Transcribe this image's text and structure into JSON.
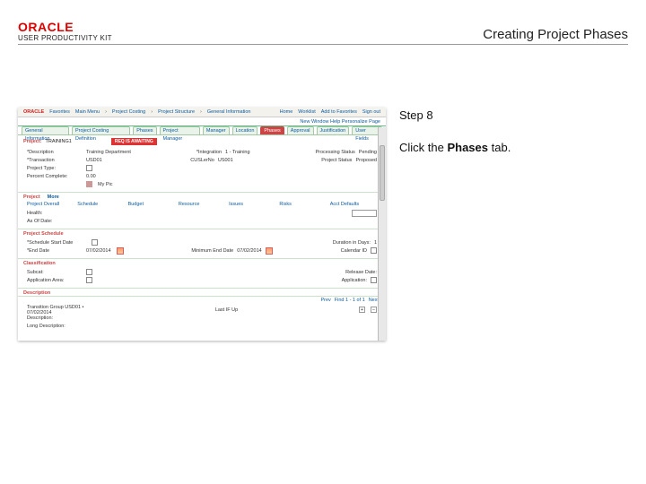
{
  "header": {
    "logo": "ORACLE",
    "sub": "USER PRODUCTIVITY KIT",
    "title": "Creating Project Phases"
  },
  "instruction": {
    "step": "Step 8",
    "text_pre": "Click the ",
    "text_bold": "Phases",
    "text_post": " tab."
  },
  "app": {
    "topbar": {
      "oracle": "ORACLE",
      "links": [
        "Favorites",
        "Main Menu",
        "Project Costing",
        "Project Structure",
        "General Information"
      ],
      "right": [
        "Home",
        "Worklist",
        "Add to Favorites",
        "Sign out"
      ]
    },
    "userbar": {
      "welcome": "New Window   Help   Personalize Page"
    },
    "tabs": [
      "General Information",
      "Project Costing Definition",
      "Phases",
      "Project Manager",
      "Manager",
      "Location",
      "Phases",
      "Approval",
      "Justification",
      "User Fields"
    ],
    "highlight_tab_index": 6,
    "project_line": {
      "label": "Project:",
      "value": "TRAINING1",
      "warn": "REQ IS AWAITING"
    },
    "fields": {
      "desc_lbl": "*Description",
      "desc_val": "Training Department",
      "trans_lbl": "*Transaction",
      "trans_val": "USD01",
      "ptype_lbl": "Project Type:",
      "pc_lbl": "Percent Complete:",
      "pc_val": "0.00",
      "int_lbl": "*Integration",
      "int_val": "1 - Training",
      "custno_lbl": "CUSLerNo",
      "custno_val": "US001",
      "procstat_lbl": "Processing Status",
      "procstat_val": "Pending",
      "projstat_lbl": "Project Status",
      "projstat_val": "Proposed",
      "mpic_lbl": "My Pic"
    },
    "section_project": "Project",
    "more_link": "More",
    "hdr_cols": [
      "Project Overall",
      "Schedule",
      "Budget",
      "Resource",
      "Issues",
      "Risks",
      "Acct Defaults"
    ],
    "health": "Health:",
    "list_labels": "As Of Date:",
    "section_schedule": "Project Schedule",
    "sched": {
      "start_lbl": "*Schedule Start Date",
      "start_val": "",
      "end_lbl": "*End Date",
      "end_val": "07/02/2014",
      "dur_lbl": "Duration in Days:",
      "dur_val": "1",
      "calc_lbl": "Minimum End Date",
      "calc_val": "07/02/2014",
      "calidx_lbl": "Calendar ID",
      "calidx_val": ""
    },
    "section_class": "Classification",
    "class": {
      "cat_lbl": "Subcat:",
      "app_lbl": "Application Area:",
      "rd_lbl": "Release Date:",
      "app2_lbl": "Application:"
    },
    "section_desc": "Description",
    "desc": {
      "run_lbl": "Transition Group USD01 • 07/02/2014",
      "last_lbl": "Last IF Up",
      "field_lbl": "Description:",
      "long_lbl": "Long Description:"
    },
    "pager": {
      "prev": "Prev",
      "range": "Find  1 - 1 of 1",
      "next": "Next"
    }
  }
}
